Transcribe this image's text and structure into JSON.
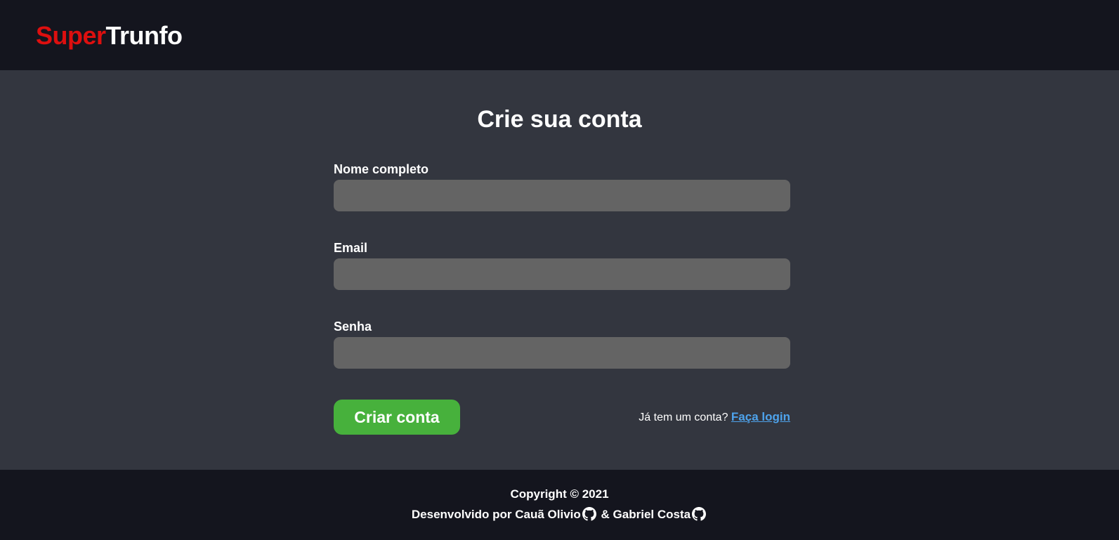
{
  "header": {
    "logo_part1": "Super",
    "logo_part2": "Trunfo"
  },
  "form": {
    "title": "Crie sua conta",
    "fields": [
      {
        "label": "Nome completo",
        "value": "",
        "placeholder": ""
      },
      {
        "label": "Email",
        "value": "",
        "placeholder": ""
      },
      {
        "label": "Senha",
        "value": "",
        "placeholder": ""
      }
    ],
    "submit_label": "Criar conta",
    "login_prompt": "Já tem um conta?",
    "login_link": "Faça login"
  },
  "footer": {
    "copyright": "Copyright © 2021",
    "credits_prefix": "Desenvolvido por",
    "author1": "Cauã Olivio",
    "separator": "&",
    "author2": "Gabriel Costa"
  },
  "colors": {
    "header_bg": "#14151e",
    "content_bg": "#33363f",
    "logo_red": "#dd0f0f",
    "input_bg": "#646464",
    "button_green": "#47b13c",
    "link_blue": "#4ea3ec"
  },
  "icons": {
    "author_icon": "github-icon"
  }
}
